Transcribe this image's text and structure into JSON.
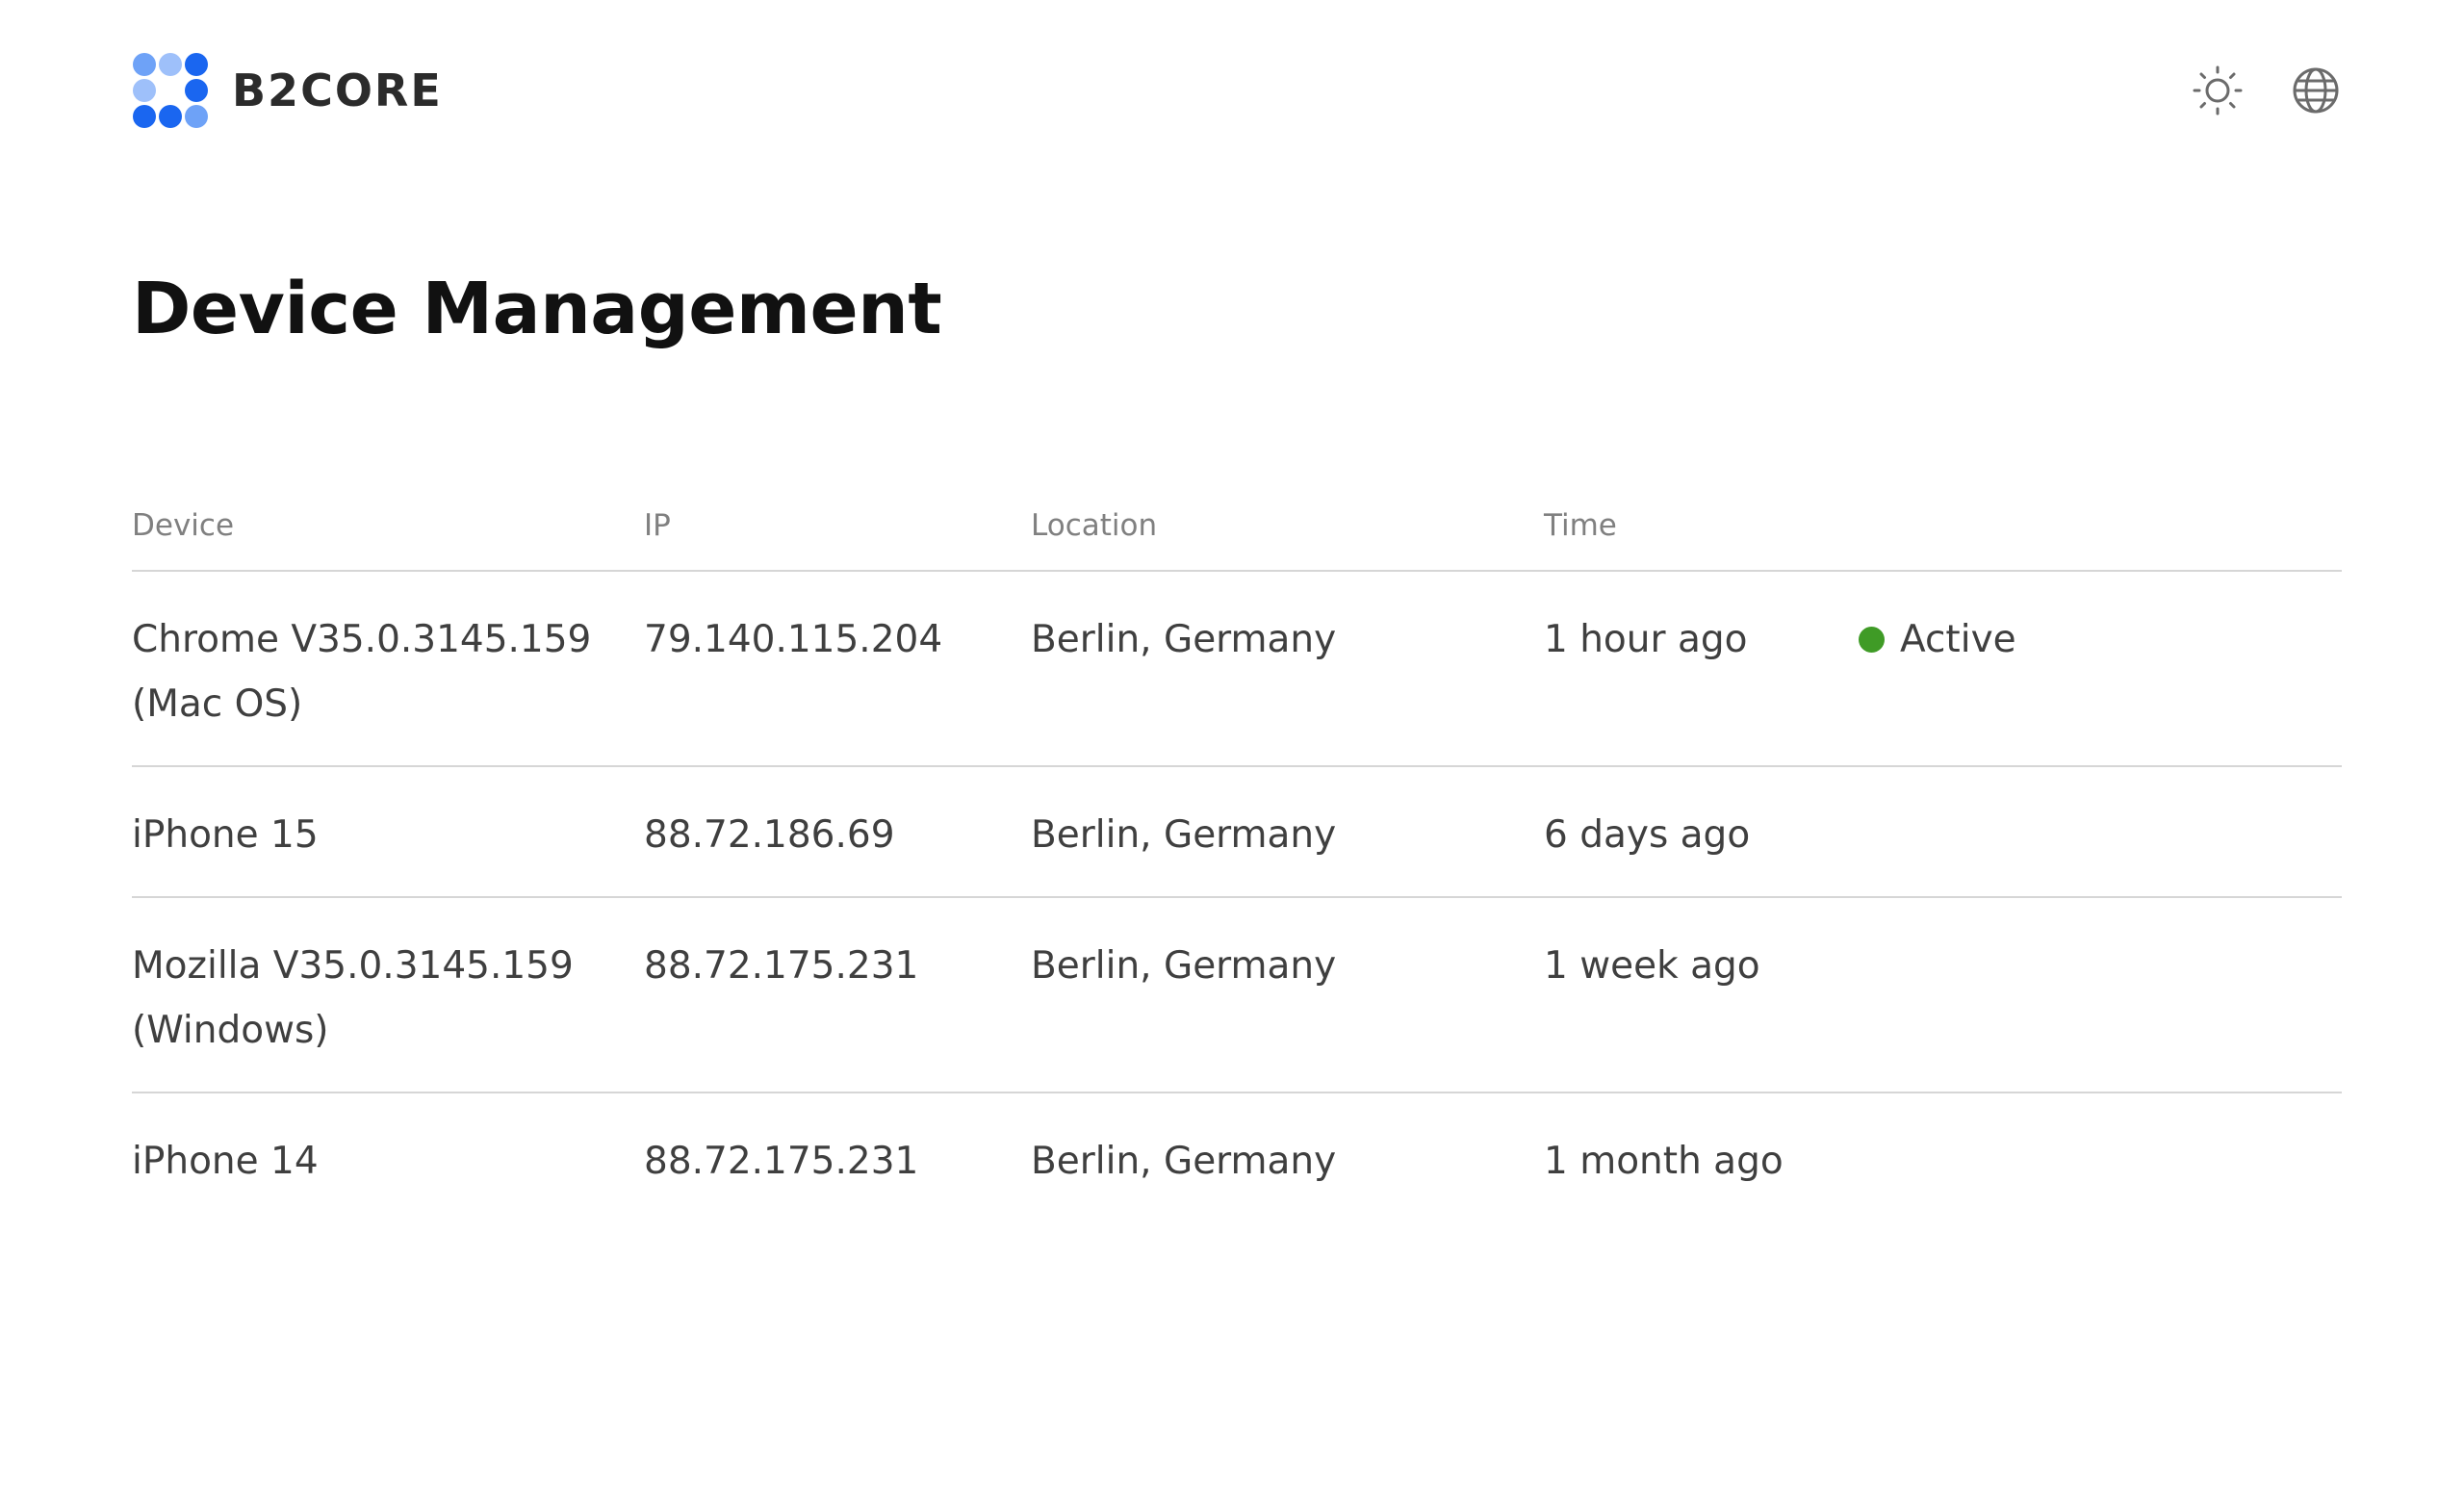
{
  "app": {
    "name": "B2CORE"
  },
  "header": {
    "theme_icon": "sun-icon",
    "language_icon": "globe-icon"
  },
  "page": {
    "title": "Device Management"
  },
  "table": {
    "columns": [
      "Device",
      "IP",
      "Location",
      "Time",
      ""
    ],
    "rows": [
      {
        "device_line1": "Chrome V35.0.3145.159",
        "device_line2": "(Mac OS)",
        "ip": "79.140.115.204",
        "location": "Berlin, Germany",
        "time": "1 hour ago",
        "status": "Active"
      },
      {
        "device_line1": "iPhone 15",
        "device_line2": "",
        "ip": "88.72.186.69",
        "location": "Berlin, Germany",
        "time": "6 days ago",
        "status": ""
      },
      {
        "device_line1": "Mozilla V35.0.3145.159",
        "device_line2": "(Windows)",
        "ip": "88.72.175.231",
        "location": "Berlin, Germany",
        "time": "1 week ago",
        "status": ""
      },
      {
        "device_line1": "iPhone 14",
        "device_line2": "",
        "ip": "88.72.175.231",
        "location": "Berlin, Germany",
        "time": "1 month ago",
        "status": ""
      }
    ]
  },
  "colors": {
    "brand_blue": "#1a66f0",
    "brand_blue_light": "#6ea2f7",
    "active_green": "#3f9b26",
    "divider": "#d6d6d6"
  }
}
